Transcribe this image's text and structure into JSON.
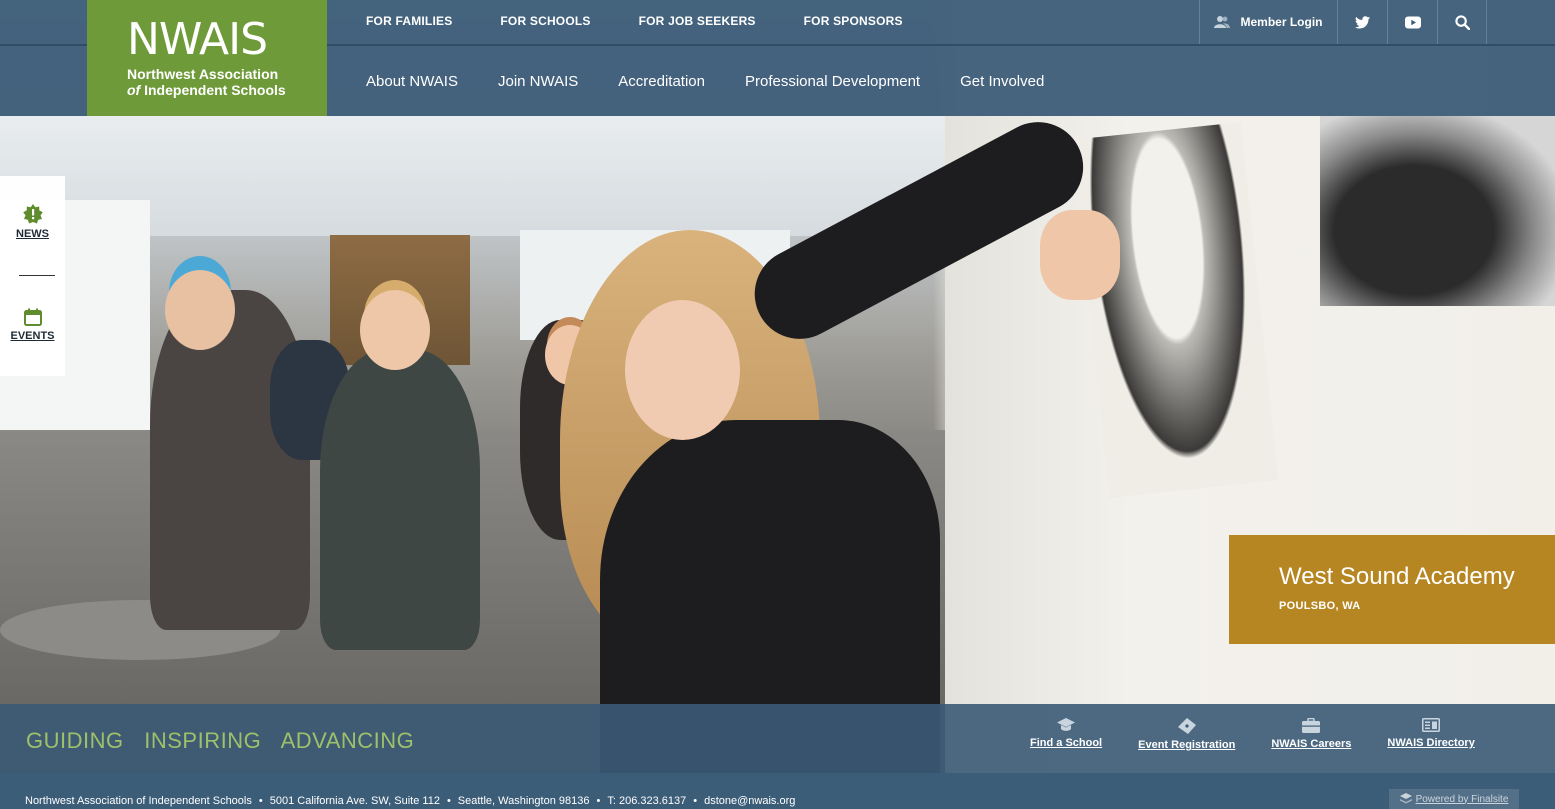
{
  "brand": {
    "wordmark": "NWAIS",
    "line1": "Northwest Association",
    "line2_prefix": "of",
    "line2_rest": " Independent Schools",
    "color": "#6f9a3a"
  },
  "utility_nav": [
    "FOR FAMILIES",
    "FOR SCHOOLS",
    "FOR JOB SEEKERS",
    "FOR SPONSORS"
  ],
  "main_nav": [
    "About NWAIS",
    "Join NWAIS",
    "Accreditation",
    "Professional Development",
    "Get Involved"
  ],
  "util_right": {
    "login_label": "Member Login",
    "icons": [
      "user-icon",
      "twitter-icon",
      "youtube-icon",
      "search-icon"
    ]
  },
  "side_panel": {
    "news_label": "NEWS",
    "events_label": "EVENTS"
  },
  "caption": {
    "school": "West Sound Academy",
    "location": "POULSBO, WA",
    "color": "#b27f17"
  },
  "tagline": [
    "GUIDING",
    "INSPIRING",
    "ADVANCING"
  ],
  "quick_links": [
    {
      "label": "Find a School",
      "icon": "graduation-cap-icon"
    },
    {
      "label": "Event Registration",
      "icon": "ticket-icon"
    },
    {
      "label": "NWAIS Careers",
      "icon": "briefcase-icon"
    },
    {
      "label": "NWAIS Directory",
      "icon": "directory-icon"
    }
  ],
  "footer": {
    "org": "Northwest Association of Independent Schools",
    "street": "5001 California Ave. SW, Suite 112",
    "city": "Seattle, Washington 98136",
    "phone": "T: 206.323.6137",
    "email": "dstone@nwais.org",
    "powered": "Powered by Finalsite"
  }
}
